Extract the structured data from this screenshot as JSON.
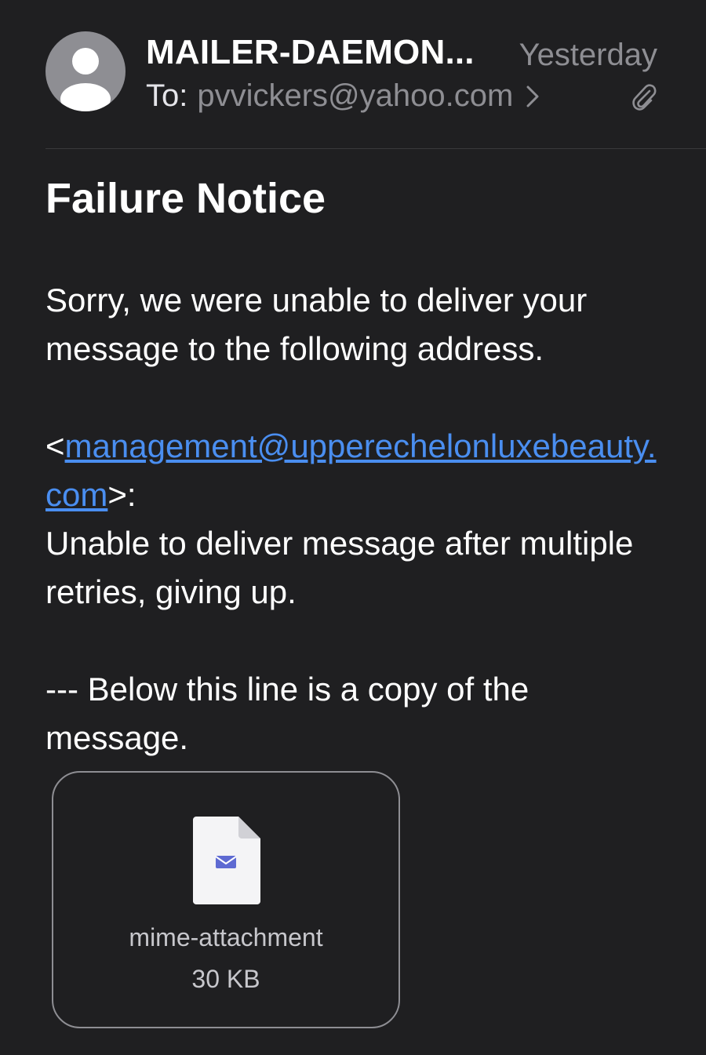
{
  "header": {
    "sender": "MAILER-DAEMON...",
    "date": "Yesterday",
    "to_label": "To:",
    "to_address": "pvvickers@yahoo.com"
  },
  "subject": "Failure Notice",
  "body": {
    "paragraph1": "Sorry, we were unable to deliver your message to the following address.",
    "link_open": "<",
    "link_text": "management@upperechelonluxebeauty.com",
    "link_close": ">:",
    "paragraph2": "Unable to deliver message after multiple retries, giving up.",
    "paragraph3": "--- Below this line is a copy of the message."
  },
  "attachment": {
    "name": "mime-attachment",
    "size": "30 KB",
    "icon": "email-file-icon"
  },
  "colors": {
    "background": "#1f1f21",
    "link": "#4a8ef0",
    "secondary_text": "#8e8e93"
  }
}
